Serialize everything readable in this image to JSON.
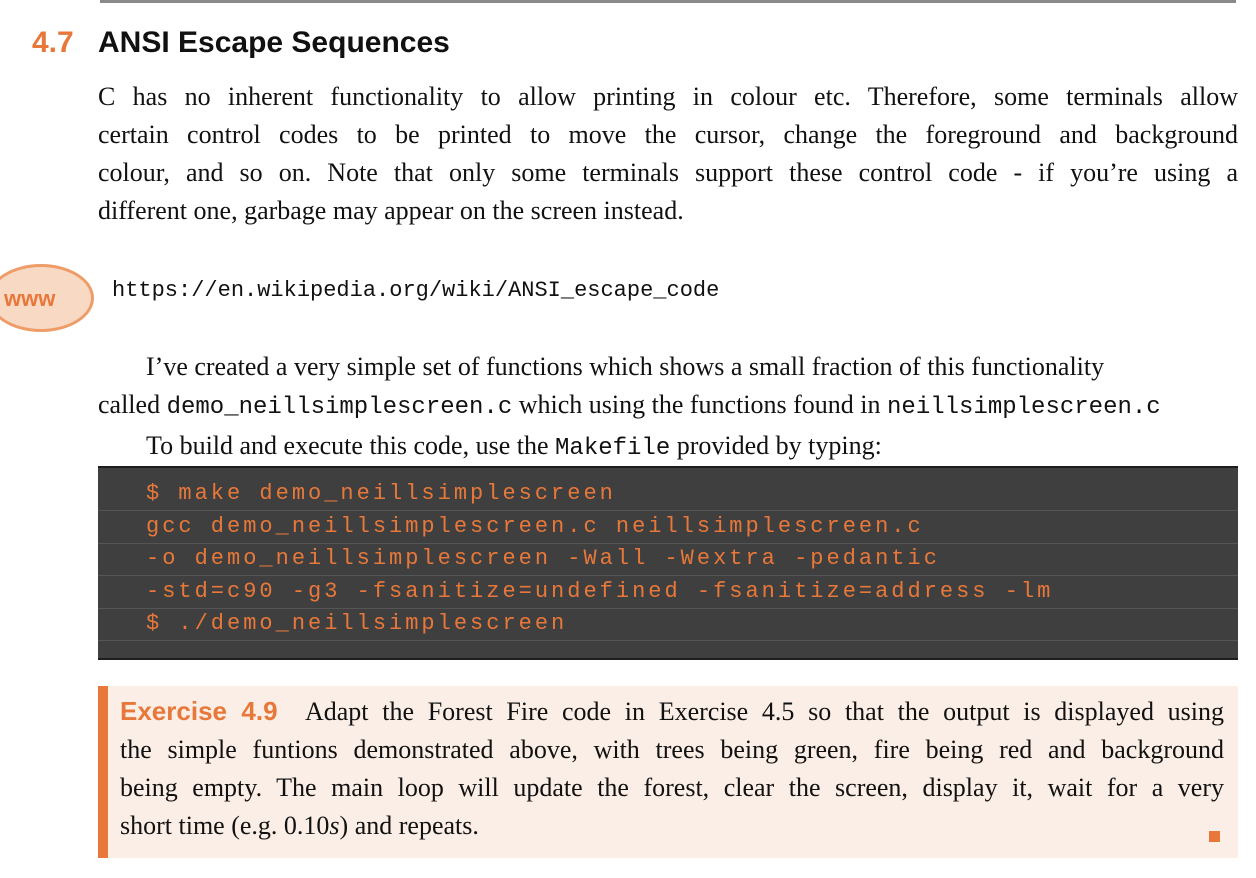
{
  "section": {
    "number": "4.7",
    "title": "ANSI Escape Sequences"
  },
  "intro": {
    "lines": [
      "C has no inherent functionality to allow printing in colour etc. Therefore, some terminals allow",
      "certain control codes to be printed to move the cursor, change the foreground and background",
      "colour, and so on. Note that only some terminals support these control code - if you’re using a",
      "different one, garbage may appear on the screen instead."
    ]
  },
  "weblink": {
    "badge": "www",
    "url": "https://en.wikipedia.org/wiki/ANSI_escape_code"
  },
  "para2": {
    "line1": "I’ve created a very simple set of functions which shows a small fraction of this functionality",
    "line2_a": "called ",
    "line2_code1": "demo_neillsimplescreen.c",
    "line2_b": " which using the functions found in ",
    "line2_code2": "neillsimplescreen.c",
    "line3_a": "To build and execute this code, use the ",
    "line3_code": "Makefile",
    "line3_b": " provided by typing:"
  },
  "code": {
    "lines": [
      "$ make demo_neillsimplescreen",
      "gcc demo_neillsimplescreen.c neillsimplescreen.c",
      "-o demo_neillsimplescreen -Wall -Wextra -pedantic",
      "-std=c90 -g3 -fsanitize=undefined -fsanitize=address -lm",
      "$ ./demo_neillsimplescreen"
    ]
  },
  "exercise": {
    "label": "Exercise 4.9",
    "line1": "Adapt the Forest Fire code in Exercise 4.5 so that the output is displayed using",
    "line2": "the simple funtions demonstrated above, with trees being green, fire being red and background",
    "line3": "being empty. The main loop will update the forest, clear the screen, display it, wait for a very",
    "line4_a": "short time (e.g. 0.10",
    "line4_s": "s",
    "line4_b": ") and repeats."
  },
  "colors": {
    "accent": "#e8783a",
    "code_bg": "#3f3f3f",
    "exercise_bg": "#fbeee6"
  }
}
